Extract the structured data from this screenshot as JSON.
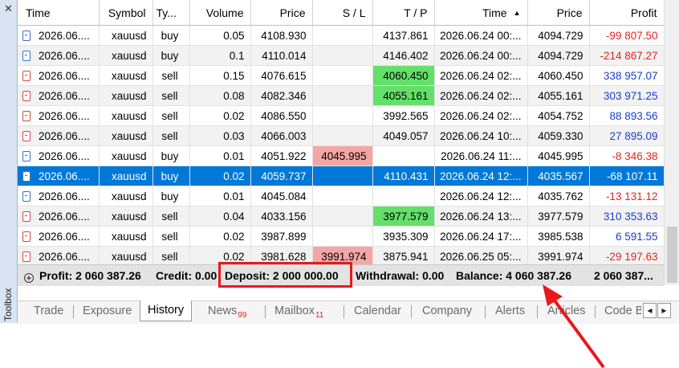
{
  "toolbox": {
    "label": "Toolbox",
    "close_glyph": "✕"
  },
  "columns": [
    "Time",
    "Symbol",
    "Ty...",
    "Volume",
    "Price",
    "S / L",
    "T / P",
    "Time",
    "Price",
    "Profit"
  ],
  "rows": [
    {
      "time": "2026.06....",
      "symbol": "xauusd",
      "type": "buy",
      "volume": "0.05",
      "price": "4108.930",
      "sl": "",
      "tp": "4137.861",
      "close_time": "2026.06.24 00:...",
      "close_price": "4094.729",
      "profit": "-99 807.50"
    },
    {
      "time": "2026.06....",
      "symbol": "xauusd",
      "type": "buy",
      "volume": "0.1",
      "price": "4110.014",
      "sl": "",
      "tp": "4146.402",
      "close_time": "2026.06.24 00:...",
      "close_price": "4094.729",
      "profit": "-214 867.27"
    },
    {
      "time": "2026.06....",
      "symbol": "xauusd",
      "type": "sell",
      "volume": "0.15",
      "price": "4076.615",
      "sl": "",
      "tp": "4060.450",
      "close_time": "2026.06.24 02:...",
      "close_price": "4060.450",
      "profit": "338 957.07"
    },
    {
      "time": "2026.06....",
      "symbol": "xauusd",
      "type": "sell",
      "volume": "0.08",
      "price": "4082.346",
      "sl": "",
      "tp": "4055.161",
      "close_time": "2026.06.24 02:...",
      "close_price": "4055.161",
      "profit": "303 971.25"
    },
    {
      "time": "2026.06....",
      "symbol": "xauusd",
      "type": "sell",
      "volume": "0.02",
      "price": "4086.550",
      "sl": "",
      "tp": "3992.565",
      "close_time": "2026.06.24 02:...",
      "close_price": "4054.752",
      "profit": "88 893.56"
    },
    {
      "time": "2026.06....",
      "symbol": "xauusd",
      "type": "sell",
      "volume": "0.03",
      "price": "4066.003",
      "sl": "",
      "tp": "4049.057",
      "close_time": "2026.06.24 10:...",
      "close_price": "4059.330",
      "profit": "27 895.09"
    },
    {
      "time": "2026.06....",
      "symbol": "xauusd",
      "type": "buy",
      "volume": "0.01",
      "price": "4051.922",
      "sl": "4045.995",
      "tp": "",
      "close_time": "2026.06.24 11:...",
      "close_price": "4045.995",
      "profit": "-8 346.38"
    },
    {
      "time": "2026.06....",
      "symbol": "xauusd",
      "type": "buy",
      "volume": "0.02",
      "price": "4059.737",
      "sl": "",
      "tp": "4110.431",
      "close_time": "2026.06.24 12:...",
      "close_price": "4035.567",
      "profit": "-68 107.11"
    },
    {
      "time": "2026.06....",
      "symbol": "xauusd",
      "type": "buy",
      "volume": "0.01",
      "price": "4045.084",
      "sl": "",
      "tp": "",
      "close_time": "2026.06.24 12:...",
      "close_price": "4035.762",
      "profit": "-13 131.12"
    },
    {
      "time": "2026.06....",
      "symbol": "xauusd",
      "type": "sell",
      "volume": "0.04",
      "price": "4033.156",
      "sl": "",
      "tp": "3977.579",
      "close_time": "2026.06.24 13:...",
      "close_price": "3977.579",
      "profit": "310 353.63"
    },
    {
      "time": "2026.06....",
      "symbol": "xauusd",
      "type": "sell",
      "volume": "0.02",
      "price": "3987.899",
      "sl": "",
      "tp": "3935.309",
      "close_time": "2026.06.24 17:...",
      "close_price": "3985.538",
      "profit": "6 591.55"
    },
    {
      "time": "2026.06....",
      "symbol": "xauusd",
      "type": "sell",
      "volume": "0.02",
      "price": "3981.628",
      "sl": "3991.974",
      "tp": "3875.941",
      "close_time": "2026.06.25 05:...",
      "close_price": "3991.974",
      "profit": "-29 197.63"
    }
  ],
  "summary": {
    "profit": "Profit: 2 060 387.26",
    "credit": "Credit: 0.00",
    "deposit": "Deposit: 2 000 000.00",
    "withdrawal": "Withdrawal: 0.00",
    "balance": "Balance: 4 060 387.26",
    "total": "2 060 387..."
  },
  "tabs": [
    {
      "label": "Trade",
      "badge": ""
    },
    {
      "label": "Exposure",
      "badge": ""
    },
    {
      "label": "History",
      "badge": ""
    },
    {
      "label": "News",
      "badge": "99"
    },
    {
      "label": "Mailbox",
      "badge": "11"
    },
    {
      "label": "Calendar",
      "badge": ""
    },
    {
      "label": "Company",
      "badge": ""
    },
    {
      "label": "Alerts",
      "badge": ""
    },
    {
      "label": "Articles",
      "badge": ""
    },
    {
      "label": "Code B",
      "badge": ""
    }
  ],
  "active_tab": "History",
  "selected_row": 7,
  "colors": {
    "selection": "#0078d7",
    "negative_profit": "#e0251b",
    "positive_profit": "#1a3ccc",
    "tp_hit": "#64e06a",
    "sl_hit": "#f4a5a5",
    "annotation": "#e8191a"
  },
  "annotation": {
    "highlight": "Deposit: 2 000 000.00",
    "arrow_target": "Balance: 4 060 387.26"
  }
}
